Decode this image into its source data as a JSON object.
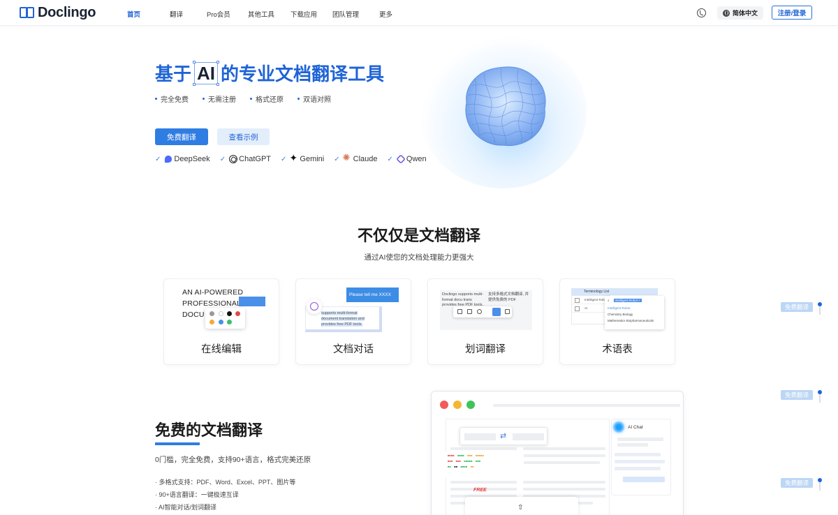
{
  "brand": {
    "name": "Doclingo"
  },
  "nav": {
    "items": [
      {
        "label": "首页",
        "active": true
      },
      {
        "label": "翻译",
        "active": false
      },
      {
        "label": "Pro会员",
        "active": false
      },
      {
        "label": "其他工具",
        "active": false
      },
      {
        "label": "下载应用",
        "active": false
      },
      {
        "label": "团队管理",
        "active": false
      },
      {
        "label": "更多",
        "active": false
      }
    ],
    "language": "简体中文",
    "login": "注册/登录"
  },
  "hero": {
    "title_prefix": "基于",
    "title_ai": "AI",
    "title_suffix": "的专业文档翻译工具",
    "features": [
      "完全免费",
      "无需注册",
      "格式还原",
      "双语对照"
    ],
    "primary_button": "免费翻译",
    "secondary_button": "查看示例",
    "models": [
      "DeepSeek",
      "ChatGPT",
      "Gemini",
      "Claude",
      "Qwen"
    ]
  },
  "section2": {
    "title": "不仅仅是文档翻译",
    "subtitle": "通过AI使您的文档处理能力更强大",
    "cards": [
      {
        "label": "在线编辑",
        "preview_text": "AN AI-POWERED PROFESSIONAL DOCU"
      },
      {
        "label": "文档对话",
        "bubble": "Please tell me XXXX",
        "preview_text": "supports multi-format document translation and provides free PDF tools."
      },
      {
        "label": "划词翻译",
        "left_text": "Doclingo supports multi-format docu trans provides free PDF tools.",
        "right_text": "支持多格式文档翻译, 并提供免费的 PDF"
      },
      {
        "label": "术语表",
        "head": "Terminology List",
        "rows": [
          "Intelligent Robot",
          "AI"
        ],
        "tag": "Intelligent Robot ×",
        "pop_rows": [
          "Chemistry  Biology",
          "Mathematics  Biopharmaceuticals"
        ]
      }
    ]
  },
  "section3": {
    "title": "免费的文档翻译",
    "desc": "0门槛，完全免费，支持90+语言，格式完美还原",
    "bullets": [
      "· 多格式支持：PDF、Word、Excel、PPT、图片等",
      "· 90+语言翻译：一键极速互译",
      "· AI智能对话/划词翻译"
    ],
    "mock": {
      "free_badge": "FREE",
      "chat_title": "AI Chat"
    }
  },
  "side_tags": [
    "免费翻译",
    "免费翻译",
    "免费翻译"
  ],
  "colors": {
    "accent": "#1f64d6",
    "primary_button": "#2f7de2"
  }
}
